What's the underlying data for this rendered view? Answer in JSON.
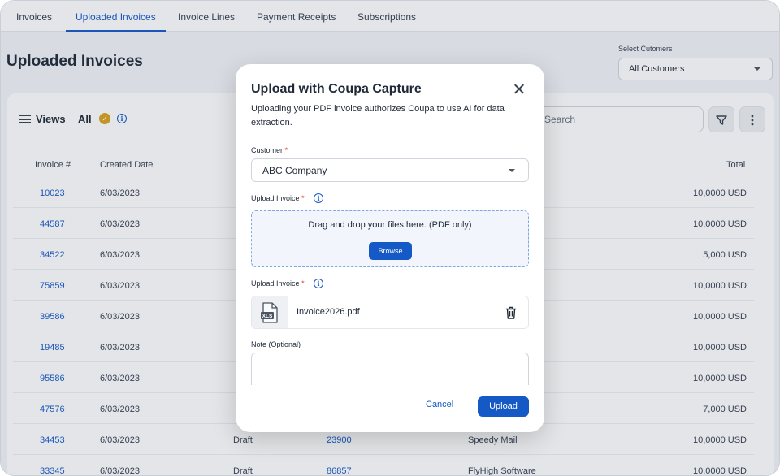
{
  "tabs": [
    {
      "label": "Invoices",
      "active": false
    },
    {
      "label": "Uploaded Invoices",
      "active": true
    },
    {
      "label": "Invoice Lines",
      "active": false
    },
    {
      "label": "Payment Receipts",
      "active": false
    },
    {
      "label": "Subscriptions",
      "active": false
    }
  ],
  "page_title": "Uploaded Invoices",
  "customer_filter": {
    "label": "Select Cutomers",
    "value": "All Customers"
  },
  "toolbar": {
    "views_label": "Views",
    "view_name": "All",
    "search_placeholder": "Search"
  },
  "table": {
    "columns": [
      "Invoice #",
      "Created Date",
      "",
      "",
      "",
      "Total"
    ],
    "rows": [
      {
        "invoice": "10023",
        "created": "6/03/2023",
        "status": "",
        "po": "",
        "supplier": "",
        "total": "10,0000 USD"
      },
      {
        "invoice": "44587",
        "created": "6/03/2023",
        "status": "",
        "po": "",
        "supplier": "",
        "total": "10,0000 USD"
      },
      {
        "invoice": "34522",
        "created": "6/03/2023",
        "status": "",
        "po": "",
        "supplier": "",
        "total": "5,000 USD"
      },
      {
        "invoice": "75859",
        "created": "6/03/2023",
        "status": "",
        "po": "",
        "supplier": "",
        "total": "10,0000 USD"
      },
      {
        "invoice": "39586",
        "created": "6/03/2023",
        "status": "",
        "po": "",
        "supplier": "",
        "total": "10,0000 USD"
      },
      {
        "invoice": "19485",
        "created": "6/03/2023",
        "status": "",
        "po": "",
        "supplier": "",
        "total": "10,0000 USD"
      },
      {
        "invoice": "95586",
        "created": "6/03/2023",
        "status": "",
        "po": "",
        "supplier": "",
        "total": "10,0000 USD"
      },
      {
        "invoice": "47576",
        "created": "6/03/2023",
        "status": "",
        "po": "",
        "supplier": "",
        "total": "7,000 USD"
      },
      {
        "invoice": "34453",
        "created": "6/03/2023",
        "status": "Draft",
        "po": "23900",
        "supplier": "Speedy Mail",
        "total": "10,0000 USD"
      },
      {
        "invoice": "33345",
        "created": "6/03/2023",
        "status": "Draft",
        "po": "86857",
        "supplier": "FlyHigh Software",
        "total": "10,0000 USD"
      }
    ]
  },
  "modal": {
    "title": "Upload with Coupa Capture",
    "description": "Uploading your PDF invoice authorizes Coupa to use AI for data extraction.",
    "customer_label": "Customer",
    "customer_value": "ABC Company",
    "upload_label_1": "Upload Invoice",
    "dropzone_text": "Drag and drop your files here. (PDF only)",
    "browse_label": "Browse",
    "upload_label_2": "Upload Invoice",
    "file_type": "XLS",
    "file_name": "Invoice2026.pdf",
    "note_label": "Note (Optional)",
    "note_value": "",
    "cancel_label": "Cancel",
    "upload_button": "Upload",
    "required_mark": "*"
  },
  "colors": {
    "accent": "#1559c7",
    "required": "#d92d20",
    "badge": "#d9a21b"
  }
}
